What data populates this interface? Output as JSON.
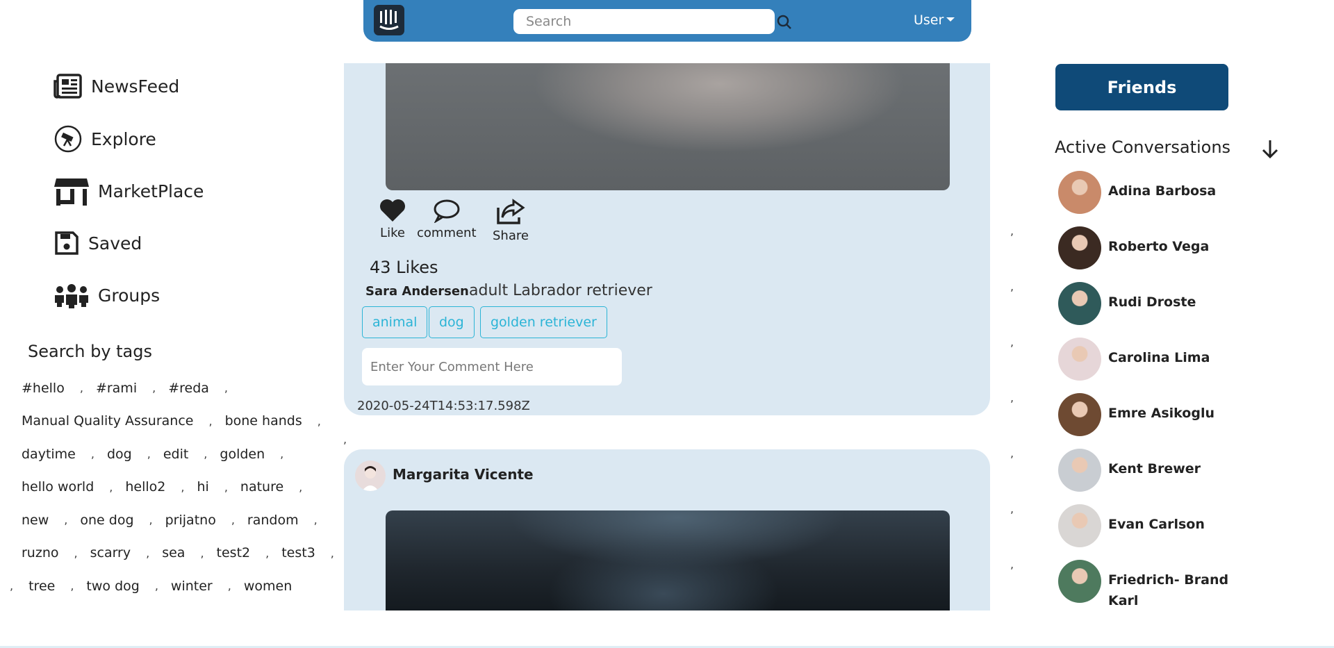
{
  "nav": {
    "search_placeholder": "Search",
    "user_label": "User"
  },
  "sidebar": {
    "items": [
      {
        "label": "NewsFeed",
        "icon": "newspaper-icon"
      },
      {
        "label": "Explore",
        "icon": "telescope-icon"
      },
      {
        "label": "MarketPlace",
        "icon": "store-icon"
      },
      {
        "label": "Saved",
        "icon": "save-icon"
      },
      {
        "label": "Groups",
        "icon": "users-icon"
      }
    ]
  },
  "tags": {
    "title": "Search by tags",
    "separator": ",",
    "rows": [
      [
        "#hello",
        "#rami",
        "#reda"
      ],
      [
        "Manual Quality Assurance",
        "bone hands"
      ],
      [
        "daytime",
        "dog",
        "edit",
        "golden"
      ],
      [
        "hello world",
        "hello2",
        "hi",
        "nature"
      ],
      [
        "new",
        "one dog",
        "prijatno",
        "random"
      ],
      [
        "ruzno",
        "scarry",
        "sea",
        "test2",
        "test3"
      ],
      [
        "tree",
        "two dog",
        "winter",
        "women"
      ]
    ]
  },
  "post1": {
    "actions": {
      "like": "Like",
      "comment": "comment",
      "share": "Share"
    },
    "likes": "43 Likes",
    "author": "Sara Andersen",
    "caption": "adult Labrador retriever",
    "tags": [
      "animal",
      "dog",
      "golden retriever"
    ],
    "comment_placeholder": "Enter Your Comment Here",
    "timestamp": "2020-05-24T14:53:17.598Z"
  },
  "post2": {
    "author": "Margarita Vicente"
  },
  "right": {
    "friends_label": "Friends",
    "conversations_title": "Active Conversations",
    "separator": ",",
    "friends": [
      {
        "name": "Adina Barbosa",
        "color": "#c98a6a"
      },
      {
        "name": "Roberto Vega",
        "color": "#3b2a22"
      },
      {
        "name": "Rudi Droste",
        "color": "#2f5a5a"
      },
      {
        "name": "Carolina Lima",
        "color": "#e6d6d8"
      },
      {
        "name": "Emre Asikoglu",
        "color": "#6e4a32"
      },
      {
        "name": "Kent Brewer",
        "color": "#c9cdd2"
      },
      {
        "name": "Evan Carlson",
        "color": "#d9d6d4"
      },
      {
        "name": "Friedrich- Brand Karl",
        "color": "#4e7a5e"
      }
    ]
  }
}
